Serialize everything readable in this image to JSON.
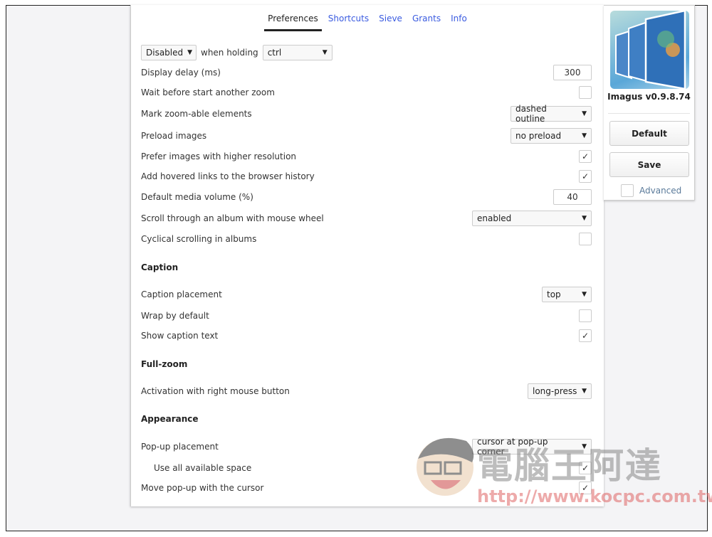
{
  "tabs": [
    "Preferences",
    "Shortcuts",
    "Sieve",
    "Grants",
    "Info"
  ],
  "activation": {
    "mode": "Disabled",
    "when_holding": "when holding",
    "key": "ctrl"
  },
  "settings": [
    {
      "label": "Display delay (ms)",
      "type": "number",
      "value": "300"
    },
    {
      "label": "Wait before start another zoom",
      "type": "checkbox",
      "checked": false
    },
    {
      "label": "Mark zoom-able elements",
      "type": "select",
      "value": "dashed outline"
    },
    {
      "label": "Preload images",
      "type": "select",
      "value": "no preload"
    },
    {
      "label": "Prefer images with higher resolution",
      "type": "checkbox",
      "checked": true
    },
    {
      "label": "Add hovered links to the browser history",
      "type": "checkbox",
      "checked": true
    },
    {
      "label": "Default media volume (%)",
      "type": "number",
      "value": "40"
    },
    {
      "label": "Scroll through an album with mouse wheel",
      "type": "select",
      "value": "enabled"
    },
    {
      "label": "Cyclical scrolling in albums",
      "type": "checkbox",
      "checked": false
    }
  ],
  "caption": {
    "heading": "Caption",
    "items": [
      {
        "label": "Caption placement",
        "type": "select",
        "value": "top"
      },
      {
        "label": "Wrap by default",
        "type": "checkbox",
        "checked": false
      },
      {
        "label": "Show caption text",
        "type": "checkbox",
        "checked": true
      }
    ]
  },
  "fullzoom": {
    "heading": "Full-zoom",
    "items": [
      {
        "label": "Activation with right mouse button",
        "type": "select",
        "value": "long-press"
      }
    ]
  },
  "appearance": {
    "heading": "Appearance",
    "items": [
      {
        "label": "Pop-up placement",
        "type": "select",
        "value": "cursor at pop-up corner"
      },
      {
        "label": "Use all available space",
        "type": "checkbox",
        "checked": true
      },
      {
        "label": "Move pop-up with the cursor",
        "type": "checkbox",
        "checked": true
      }
    ]
  },
  "sidebar": {
    "version": "Imagus v0.9.8.74",
    "default_label": "Default",
    "save_label": "Save",
    "advanced_label": "Advanced",
    "advanced_checked": false
  },
  "watermark": {
    "text": "電腦王阿達",
    "url": "http://www.kocpc.com.tw"
  },
  "colors": {
    "link": "#3a5be0",
    "background": "#f4f4f6"
  }
}
